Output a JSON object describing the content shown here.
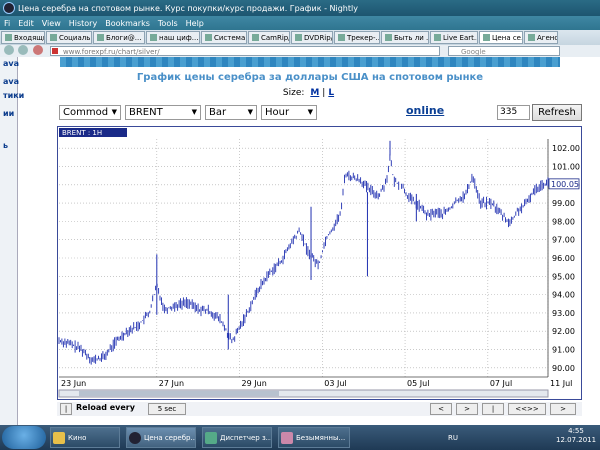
{
  "window": {
    "title": "Цена серебра на спотовом рынке. Курс покупки/курс продажи. График - Nightly",
    "menu": [
      "Fi",
      "Edit",
      "View",
      "History",
      "Bookmarks",
      "Tools",
      "Help"
    ]
  },
  "tabs": [
    "Входящи...",
    "Социаль...",
    "Блоги@...",
    "наш циф...",
    "Система...",
    "CamRip/...",
    "DVDRip/...",
    "Трекер-...",
    "Быть ли ...",
    "Live Eart...",
    "Цена се...",
    "Агенс"
  ],
  "address": {
    "url": "www.forexpf.ru/chart/silver/",
    "search_placeholder": "Google"
  },
  "leftpanel": [
    "ava",
    "ava",
    "тики",
    "ии",
    "ь"
  ],
  "page": {
    "title": "График цены серебра за доллары США на спотовом рынке",
    "size_label": "Size:",
    "size_m": "M",
    "size_sep": "|",
    "size_l": "L"
  },
  "controls": {
    "mode": "Commod",
    "symbol": "BRENT",
    "chart_type": "Bar",
    "period": "Hour",
    "online": "online",
    "count": "335",
    "refresh": "Refresh"
  },
  "bottom": {
    "label": "Reload every",
    "interval": "5 sec",
    "buttons": [
      "<",
      ">",
      "|",
      "<<",
      ">>",
      ">"
    ]
  },
  "chart_data": {
    "type": "bar",
    "legend": "BRENT : 1H",
    "x_ticks": [
      "23 Jun",
      "27 Jun",
      "29 Jun",
      "03 Jul",
      "05 Jul",
      "07 Jul",
      "11 Jul"
    ],
    "y_ticks": [
      "102.00",
      "101.00",
      "100.00",
      "99.00",
      "98.00",
      "97.00",
      "96.00",
      "95.00",
      "94.00",
      "93.00",
      "92.00",
      "91.00",
      "90.00"
    ],
    "current_value": "100.05",
    "ylim": [
      89.5,
      102.5
    ],
    "grid": true,
    "path": [
      [
        0,
        91.5
      ],
      [
        3,
        91.3
      ],
      [
        6,
        91.0
      ],
      [
        9,
        90.4
      ],
      [
        12,
        90.6
      ],
      [
        15,
        91.4
      ],
      [
        18,
        92.0
      ],
      [
        21,
        92.3
      ],
      [
        24,
        93.0
      ],
      [
        26,
        94.5
      ],
      [
        28,
        93.2
      ],
      [
        31,
        93.4
      ],
      [
        34,
        93.6
      ],
      [
        37,
        93.2
      ],
      [
        40,
        93.1
      ],
      [
        43,
        92.6
      ],
      [
        46,
        91.4
      ],
      [
        48,
        92.2
      ],
      [
        50,
        93.0
      ],
      [
        53,
        94.3
      ],
      [
        56,
        95.2
      ],
      [
        59,
        95.8
      ],
      [
        62,
        96.9
      ],
      [
        64,
        97.5
      ],
      [
        66,
        96.4
      ],
      [
        69,
        95.6
      ],
      [
        71,
        97.1
      ],
      [
        73,
        97.7
      ],
      [
        75,
        98.5
      ],
      [
        76,
        100.6
      ],
      [
        78,
        100.4
      ],
      [
        80,
        100.3
      ],
      [
        82,
        99.8
      ],
      [
        85,
        99.4
      ],
      [
        87,
        100.2
      ],
      [
        88,
        101.5
      ],
      [
        89,
        100.2
      ],
      [
        91,
        100.0
      ],
      [
        93,
        99.3
      ],
      [
        96,
        98.8
      ],
      [
        98,
        98.3
      ],
      [
        100,
        98.5
      ],
      [
        102,
        98.4
      ],
      [
        104,
        98.7
      ],
      [
        106,
        99.2
      ],
      [
        108,
        99.4
      ],
      [
        110,
        100.5
      ],
      [
        112,
        99.0
      ],
      [
        115,
        99.0
      ],
      [
        118,
        98.3
      ],
      [
        120,
        97.9
      ],
      [
        122,
        98.6
      ],
      [
        124,
        98.9
      ],
      [
        126,
        99.6
      ],
      [
        128,
        100.0
      ],
      [
        130,
        100.1
      ]
    ],
    "spikes": [
      [
        26,
        92.9,
        96.2
      ],
      [
        45,
        91.0,
        94.0
      ],
      [
        67,
        94.8,
        98.8
      ],
      [
        82,
        95.0,
        99.6
      ],
      [
        88,
        101.6,
        102.4
      ],
      [
        95,
        98.0,
        99.5
      ]
    ]
  },
  "taskbar": {
    "items": [
      "Кино",
      "Цена серебр...",
      "Диспетчер з...",
      "Безымянны..."
    ],
    "lang": "RU",
    "time": "4:55",
    "date": "12.07.2011"
  }
}
